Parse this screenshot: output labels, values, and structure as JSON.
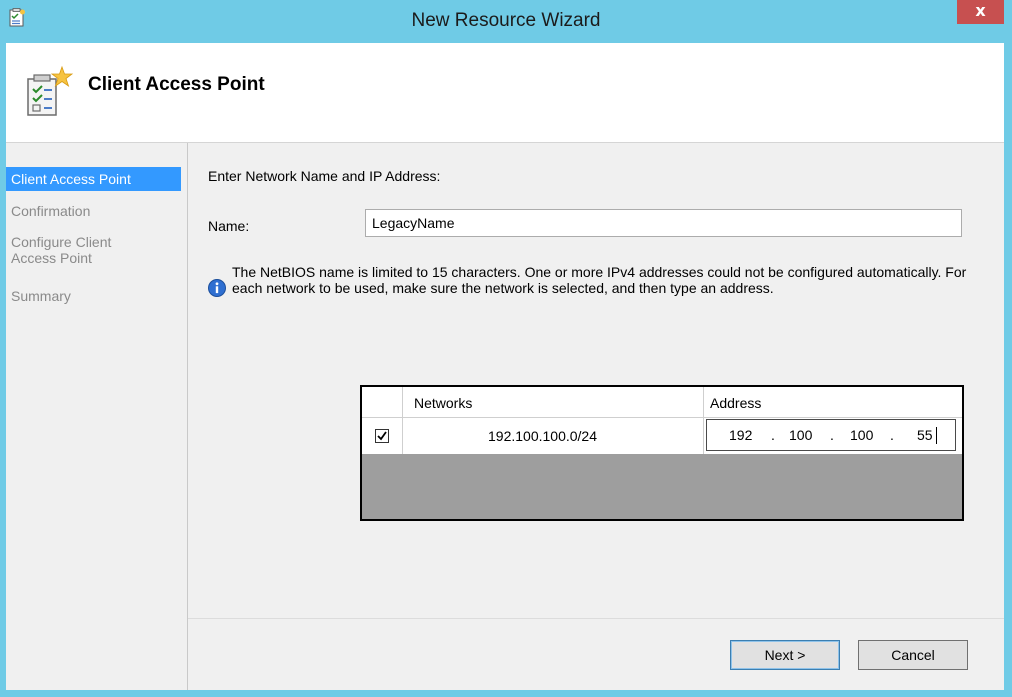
{
  "window": {
    "title": "New Resource Wizard",
    "close_label": "x"
  },
  "header": {
    "title": "Client Access Point",
    "icon": "wizard-checklist-icon"
  },
  "nav": {
    "items": [
      {
        "label": "Client Access Point",
        "selected": true
      },
      {
        "label": "Confirmation",
        "selected": false
      },
      {
        "label": "Configure Client Access Point",
        "selected": false
      },
      {
        "label": "Summary",
        "selected": false
      }
    ]
  },
  "main": {
    "instruction": "Enter Network Name and IP Address:",
    "name_label": "Name:",
    "name_value": "LegacyName",
    "info_text": "The NetBIOS name is limited to 15 characters.  One or more IPv4 addresses could not be configured automatically.  For each network to be used, make sure the network is selected, and then type an address."
  },
  "grid": {
    "columns": [
      "Networks",
      "Address"
    ],
    "rows": [
      {
        "checked": true,
        "network": "192.100.100.0/24",
        "address": [
          "192",
          "100",
          "100",
          "55"
        ]
      }
    ]
  },
  "buttons": {
    "next": "Next >",
    "cancel": "Cancel"
  },
  "colors": {
    "title_bar": "#6fcbe6",
    "close": "#c75050",
    "selection": "#3399ff"
  }
}
